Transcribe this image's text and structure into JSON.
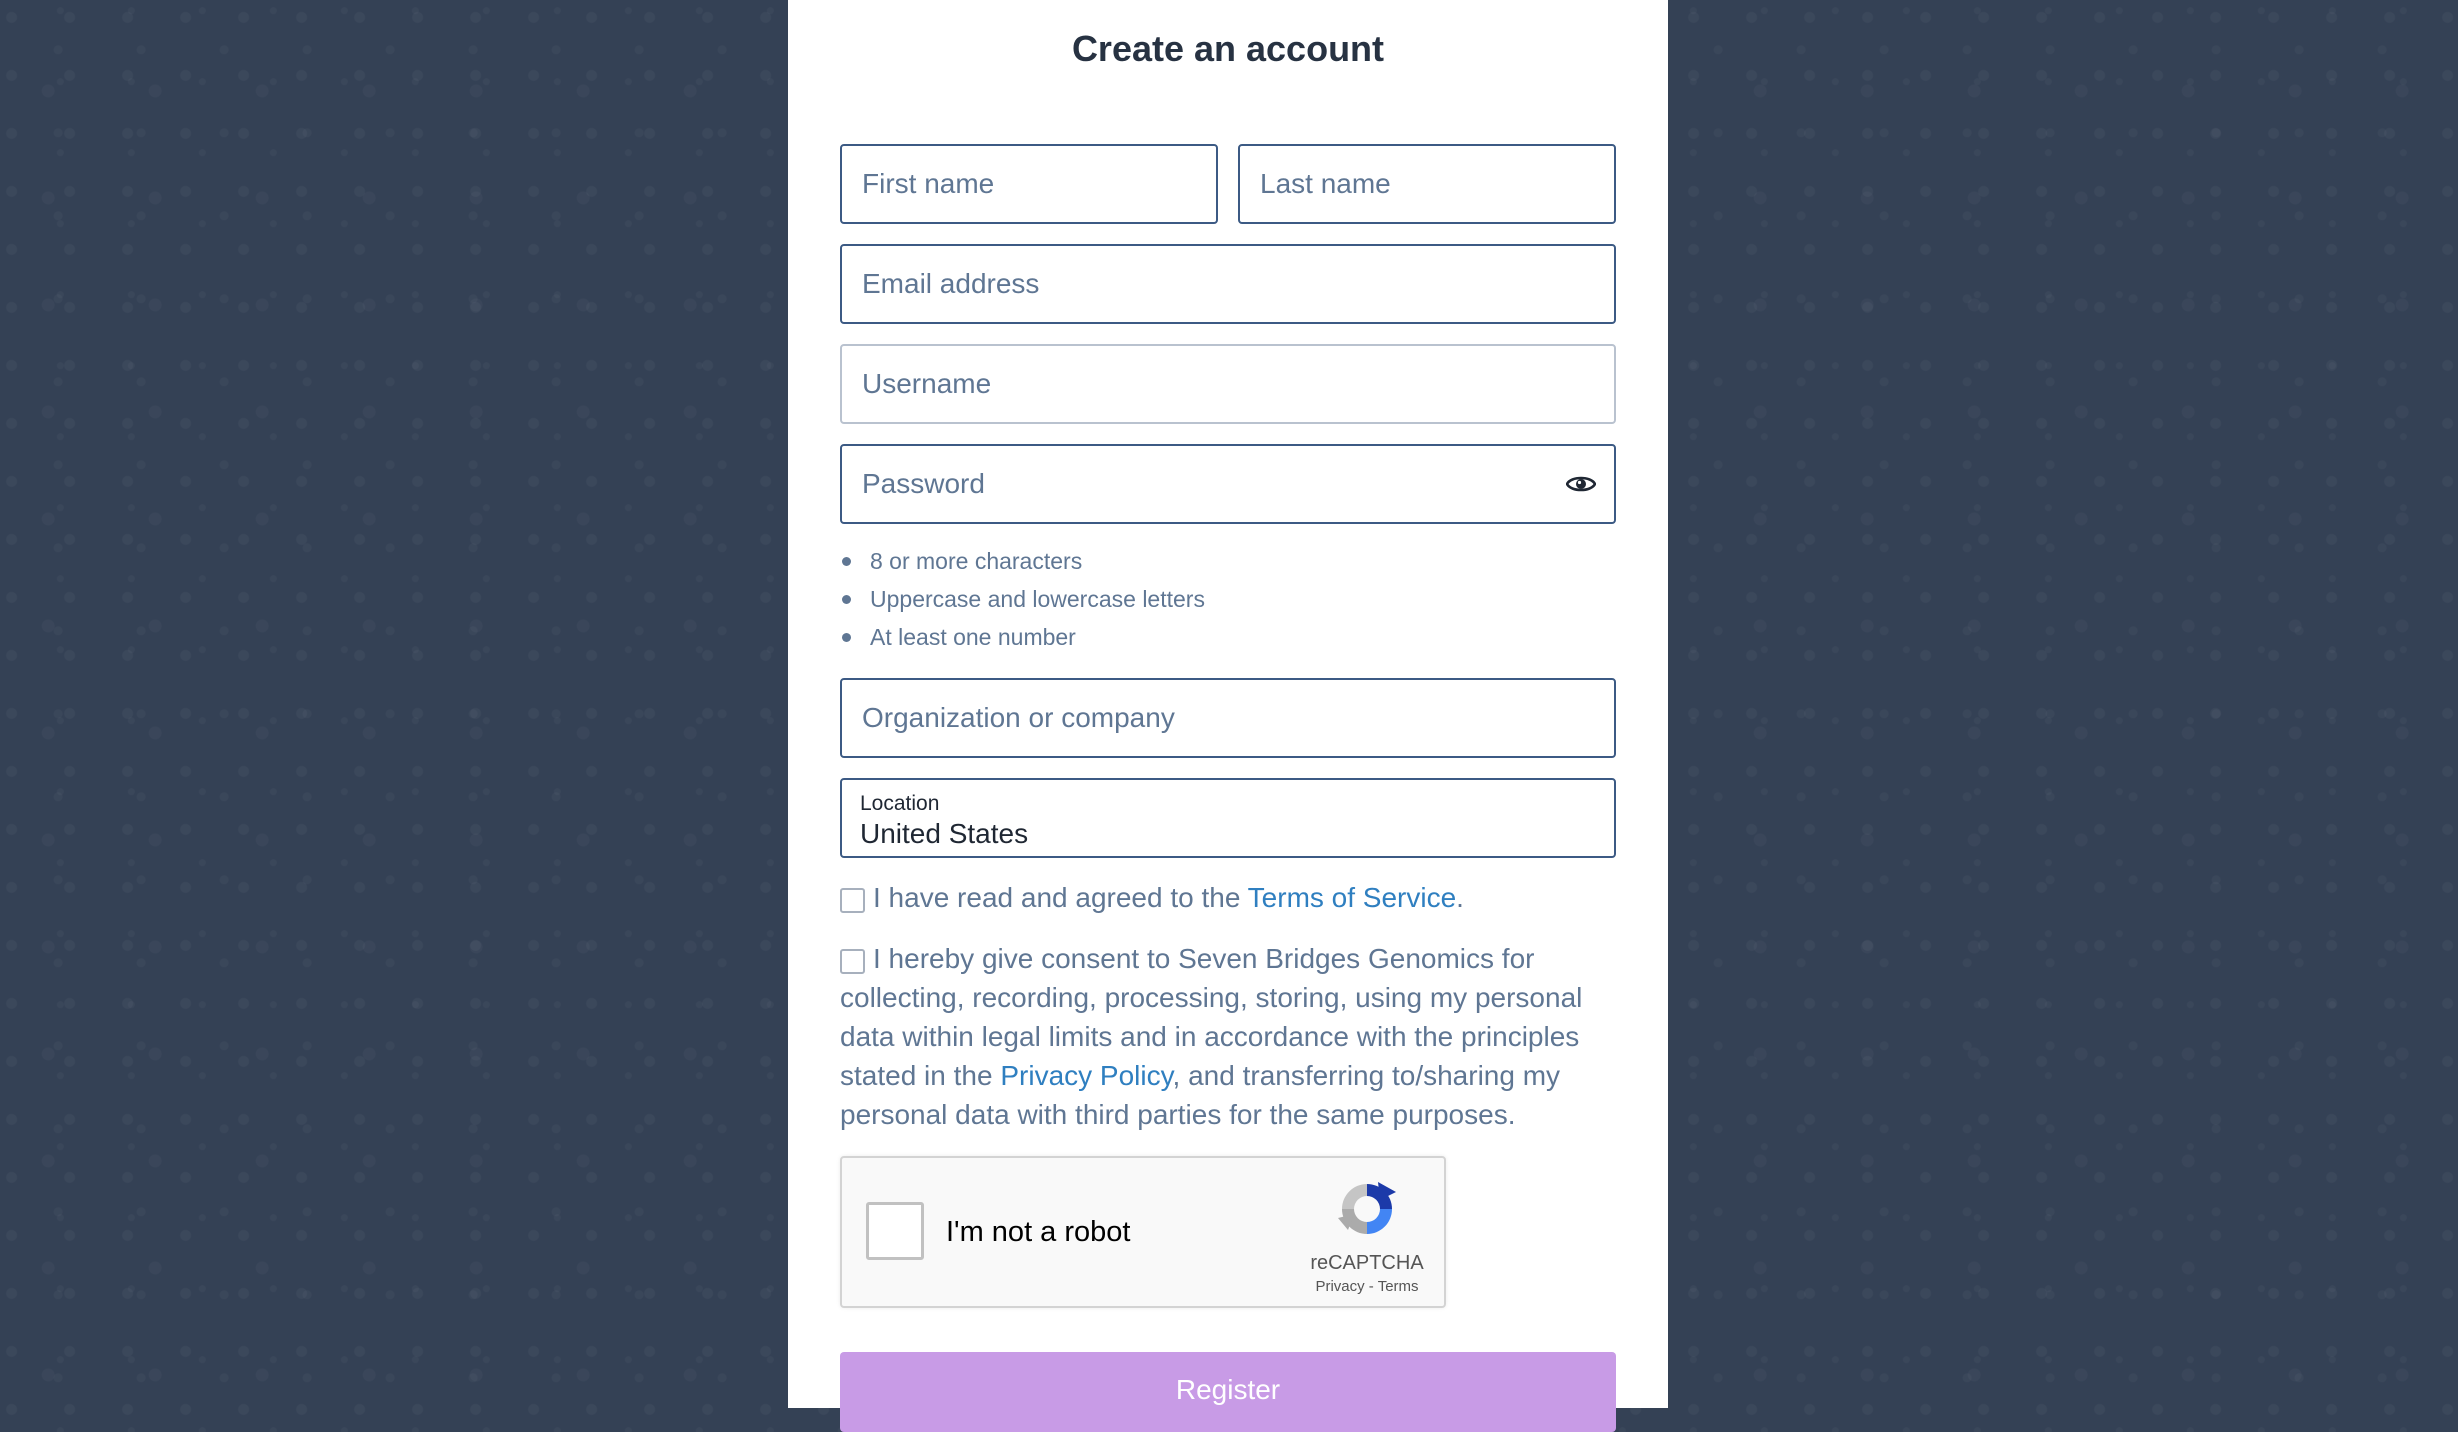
{
  "form": {
    "title": "Create an account",
    "first_name_placeholder": "First name",
    "last_name_placeholder": "Last name",
    "email_placeholder": "Email address",
    "username_placeholder": "Username",
    "password_placeholder": "Password",
    "password_toggle_icon": "eye-icon",
    "password_rules": [
      "8 or more characters",
      "Uppercase and lowercase letters",
      "At least one number"
    ],
    "organization_placeholder": "Organization or company",
    "location": {
      "label": "Location",
      "value": "United States"
    },
    "terms": {
      "text": "I have read and agreed to the ",
      "link": "Terms of Service",
      "suffix": "."
    },
    "consent": {
      "text": "I hereby give consent to Seven Bridges Genomics for collecting, recording, processing, storing, using my personal data within legal limits and in accordance with the principles stated in the ",
      "link": "Privacy Policy",
      "suffix": ", and transferring to/sharing my personal data with third parties for the same purposes."
    },
    "register_label": "Register"
  },
  "captcha": {
    "label": "I'm not a robot",
    "brand": "reCAPTCHA",
    "privacy": "Privacy",
    "separator": " - ",
    "terms": "Terms",
    "logo_icon": "recaptcha-logo-icon"
  },
  "colors": {
    "background": "#344155",
    "card": "#ffffff",
    "field_border": "#3c5a84",
    "placeholder": "#5f7693",
    "link": "#2f7fc0",
    "register_button": "#c89be6"
  }
}
